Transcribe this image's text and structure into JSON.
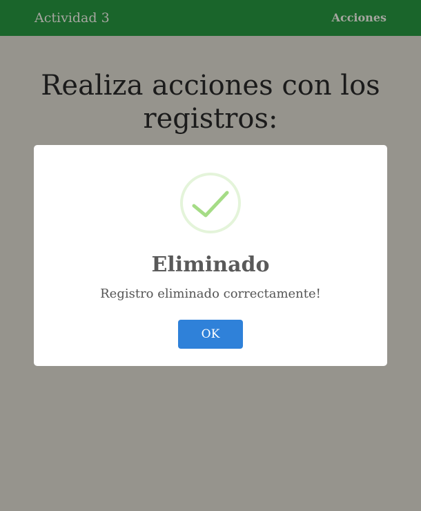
{
  "navbar": {
    "brand": "Actividad 3",
    "link": "Acciones",
    "background_color": "#1a652b"
  },
  "page": {
    "title": "Realiza acciones con los registros:",
    "overlay_color": "#96948d"
  },
  "alert": {
    "icon": "success-check-icon",
    "title": "Eliminado",
    "text": "Registro eliminado correctamente!",
    "confirm_label": "OK",
    "confirm_color": "#2f81d9",
    "icon_color": "#a5dc86"
  }
}
